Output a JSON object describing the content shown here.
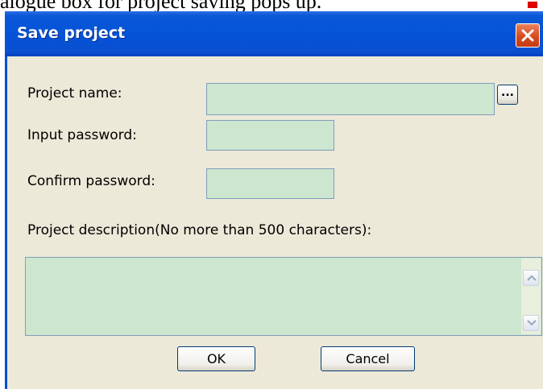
{
  "background_caption": "alogue box for project saving pops up.",
  "dialog": {
    "title": "Save project",
    "close_icon": "close-icon",
    "colors": {
      "title_bar": "#0553d8",
      "window_bg": "#ece9d8",
      "field_bg": "#cde6cf",
      "close_button": "#d84a1f"
    }
  },
  "form": {
    "project_name_label": "Project name:",
    "project_name_value": "",
    "browse_label": "...",
    "password_label": "Input password:",
    "password_value": "",
    "confirm_label": "Confirm password:",
    "confirm_value": "",
    "description_label": "Project description(No more than 500 characters):",
    "description_value": ""
  },
  "buttons": {
    "ok": "OK",
    "cancel": "Cancel"
  }
}
